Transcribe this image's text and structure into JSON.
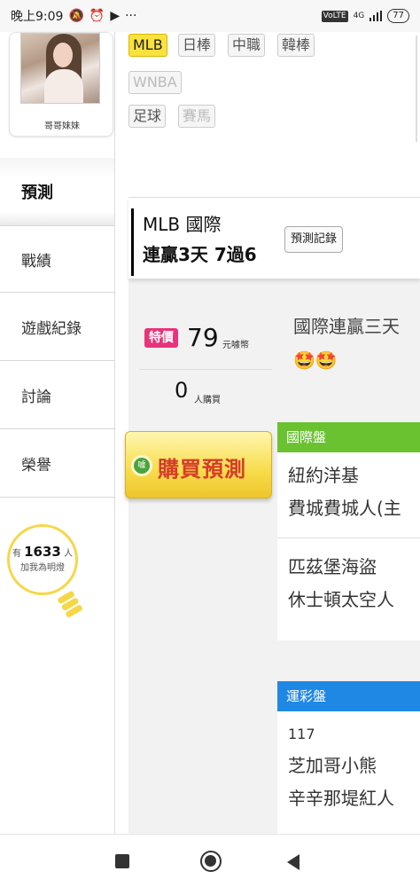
{
  "status_bar": {
    "time": "晚上9:09",
    "left_icons": [
      "mute-icon",
      "alarm-icon",
      "youtube-icon",
      "more-dots-icon"
    ],
    "more": "···",
    "network": "4G",
    "volte": "VoLTE",
    "battery": "77"
  },
  "profile": {
    "name": "哥哥妹妹"
  },
  "league_tags": [
    {
      "label": "MLB",
      "state": "active"
    },
    {
      "label": "日棒",
      "state": "normal"
    },
    {
      "label": "中職",
      "state": "normal"
    },
    {
      "label": "韓棒",
      "state": "normal"
    },
    {
      "label": "WNBA",
      "state": "disabled"
    },
    {
      "label": "足球",
      "state": "normal"
    },
    {
      "label": "賽馬",
      "state": "disabled"
    }
  ],
  "sidebar": {
    "tabs": [
      {
        "label": "預測",
        "active": true
      },
      {
        "label": "戰績",
        "active": false
      },
      {
        "label": "遊戲紀錄",
        "active": false
      },
      {
        "label": "討論",
        "active": false
      },
      {
        "label": "榮譽",
        "active": false
      }
    ],
    "fans": {
      "prefix": "有",
      "count": "1633",
      "suffix": "人",
      "caption": "加我為明燈"
    }
  },
  "header": {
    "title": "MLB 國際",
    "record": "連贏3天 7過6",
    "record_button": "預測記錄"
  },
  "price": {
    "badge": "特價",
    "amount": "79",
    "unit": "元噱幣",
    "buyers": "0",
    "buyers_unit": "人購買"
  },
  "buy_button": {
    "icon_text": "噱",
    "label": "購買預測"
  },
  "description": "國際連贏三天",
  "emojis": "🤩🤩",
  "markets": {
    "international": {
      "title": "國際盤",
      "teams": [
        "紐約洋基",
        "費城費城人(主",
        "匹茲堡海盜",
        "休士頓太空人"
      ]
    },
    "sports_lottery": {
      "title": "運彩盤",
      "code": "117",
      "teams": [
        "芝加哥小熊",
        "辛辛那堤紅人"
      ]
    }
  },
  "colors": {
    "active_tag": "#f9e23e",
    "special_badge": "#e7347a",
    "buy_text": "#d63b2a",
    "market_green": "#6ac231",
    "market_blue": "#1f88e5",
    "bulb": "#f6d749"
  }
}
